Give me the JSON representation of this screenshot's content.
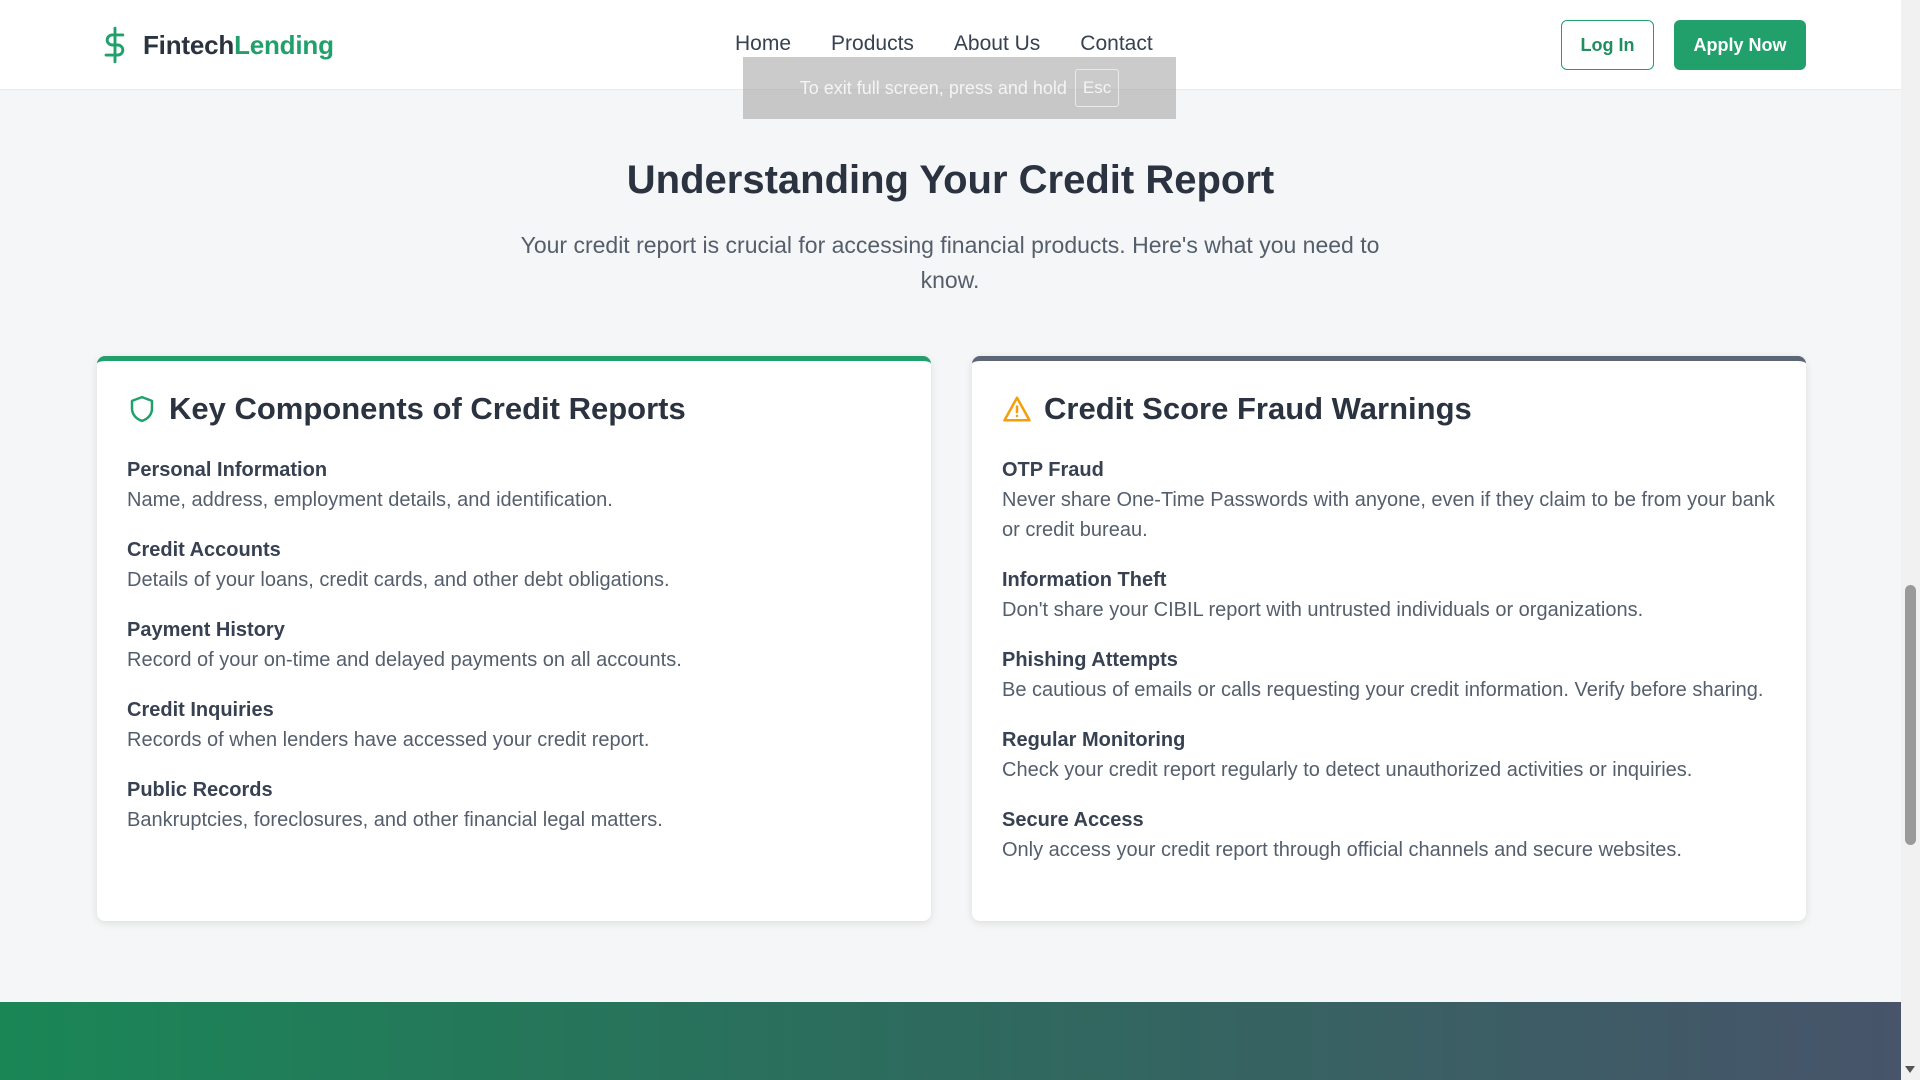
{
  "brand": {
    "name_part1": "Fintech",
    "name_part2": "Lending",
    "icon": "dollar-icon",
    "accent_color": "#22a06b"
  },
  "nav": {
    "items": [
      "Home",
      "Products",
      "About Us",
      "Contact"
    ]
  },
  "actions": {
    "login_label": "Log In",
    "apply_label": "Apply Now"
  },
  "fullscreen_notice": {
    "text": "To exit full screen, press and hold",
    "key": "Esc"
  },
  "intro": {
    "title": "Understanding Your Credit Report",
    "subtitle": "Your credit report is crucial for accessing financial products. Here's what you need to know."
  },
  "components_card": {
    "title": "Key Components of Credit Reports",
    "icon": "shield-icon",
    "items": [
      {
        "title": "Personal Information",
        "desc": "Name, address, employment details, and identification."
      },
      {
        "title": "Credit Accounts",
        "desc": "Details of your loans, credit cards, and other debt obligations."
      },
      {
        "title": "Payment History",
        "desc": "Record of your on-time and delayed payments on all accounts."
      },
      {
        "title": "Credit Inquiries",
        "desc": "Records of when lenders have accessed your credit report."
      },
      {
        "title": "Public Records",
        "desc": "Bankruptcies, foreclosures, and other financial legal matters."
      }
    ]
  },
  "fraud_card": {
    "title": "Credit Score Fraud Warnings",
    "icon": "warning-icon",
    "items": [
      {
        "title": "OTP Fraud",
        "desc": "Never share One-Time Passwords with anyone, even if they claim to be from your bank or credit bureau."
      },
      {
        "title": "Information Theft",
        "desc": "Don't share your CIBIL report with untrusted individuals or organizations."
      },
      {
        "title": "Phishing Attempts",
        "desc": "Be cautious of emails or calls requesting your credit information. Verify before sharing."
      },
      {
        "title": "Regular Monitoring",
        "desc": "Check your credit report regularly to detect unauthorized activities or inquiries."
      },
      {
        "title": "Secure Access",
        "desc": "Only access your credit report through official channels and secure websites."
      }
    ]
  }
}
